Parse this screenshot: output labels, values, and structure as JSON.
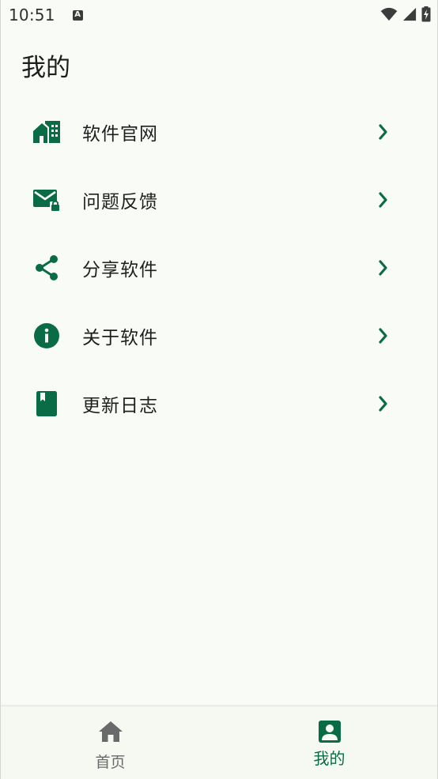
{
  "status_bar": {
    "time": "10:51",
    "notification_glyph": "A",
    "icons": [
      "wifi-icon",
      "signal-icon",
      "battery-charging-icon"
    ]
  },
  "page": {
    "title": "我的"
  },
  "menu": {
    "items": [
      {
        "label": "软件官网",
        "icon": "website-icon"
      },
      {
        "label": "问题反馈",
        "icon": "mail-lock-icon"
      },
      {
        "label": "分享软件",
        "icon": "share-icon"
      },
      {
        "label": "关于软件",
        "icon": "info-icon"
      },
      {
        "label": "更新日志",
        "icon": "book-icon"
      }
    ]
  },
  "bottom_nav": {
    "tabs": [
      {
        "label": "首页",
        "icon": "home-icon",
        "selected": false
      },
      {
        "label": "我的",
        "icon": "account-box-icon",
        "selected": true
      }
    ]
  },
  "colors": {
    "accent": "#0a6b47",
    "background": "#f9fbf6",
    "inactive": "#6a6a6a"
  }
}
